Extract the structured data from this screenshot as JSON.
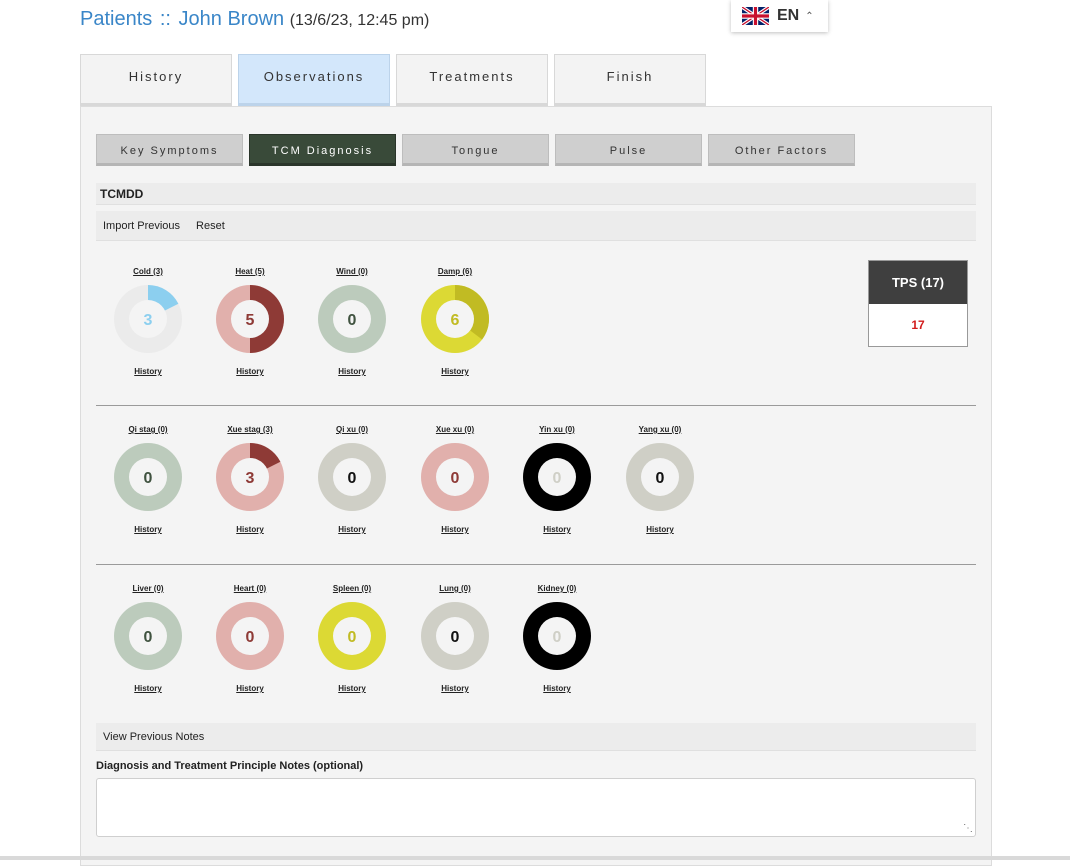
{
  "breadcrumb": {
    "root": "Patients",
    "separator": "::",
    "patient": "John Brown",
    "datetime": "(13/6/23, 12:45 pm)"
  },
  "language": {
    "code": "EN",
    "flag_icon": "uk-flag-icon"
  },
  "tabs": [
    {
      "label": "History",
      "active": false
    },
    {
      "label": "Observations",
      "active": true
    },
    {
      "label": "Treatments",
      "active": false
    },
    {
      "label": "Finish",
      "active": false
    }
  ],
  "subtabs": [
    {
      "label": "Key Symptoms",
      "active": false
    },
    {
      "label": "TCM Diagnosis",
      "active": true
    },
    {
      "label": "Tongue",
      "active": false
    },
    {
      "label": "Pulse",
      "active": false
    },
    {
      "label": "Other Factors",
      "active": false
    }
  ],
  "section_title": "TCMDD",
  "actions": {
    "import_previous": "Import Previous",
    "reset": "Reset"
  },
  "history_label": "History",
  "gauges_row1": [
    {
      "label": "Cold (3)",
      "value": "3",
      "fraction": 0.176,
      "fill": "#8ccfef",
      "track": "#ebebeb",
      "center": "#f4f4f4",
      "text": "#8ccfef"
    },
    {
      "label": "Heat (5)",
      "value": "5",
      "fraction": 0.5,
      "fill": "#8e3a36",
      "track": "#e1b0ac",
      "center": "#f4f4f4",
      "text": "#8e3a36"
    },
    {
      "label": "Wind (0)",
      "value": "0",
      "fraction": 0,
      "fill": "#bccbbc",
      "track": "#bccbbc",
      "center": "#f4f4f4",
      "text": "#3f523f"
    },
    {
      "label": "Damp (6)",
      "value": "6",
      "fraction": 0.353,
      "fill": "#c1bb23",
      "track": "#dcd934",
      "center": "#f4f4f4",
      "text": "#c1bb23"
    }
  ],
  "gauges_row2": [
    {
      "label": "Qi stag (0)",
      "value": "0",
      "fraction": 0,
      "fill": "#bccbbc",
      "track": "#bccbbc",
      "center": "#f4f4f4",
      "text": "#3f523f"
    },
    {
      "label": "Xue stag (3)",
      "value": "3",
      "fraction": 0.176,
      "fill": "#8e3a36",
      "track": "#e1b0ac",
      "center": "#f4f4f4",
      "text": "#8e3a36"
    },
    {
      "label": "Qi xu (0)",
      "value": "0",
      "fraction": 0,
      "fill": "#cfcfc6",
      "track": "#cfcfc6",
      "center": "#f4f4f4",
      "text": "#111111"
    },
    {
      "label": "Xue xu (0)",
      "value": "0",
      "fraction": 0,
      "fill": "#e1b0ac",
      "track": "#e1b0ac",
      "center": "#f4f4f4",
      "text": "#8e3a36"
    },
    {
      "label": "Yin xu (0)",
      "value": "0",
      "fraction": 0,
      "fill": "#000000",
      "track": "#000000",
      "center": "#f4f4f4",
      "text": "#cfcfc6"
    },
    {
      "label": "Yang xu (0)",
      "value": "0",
      "fraction": 0,
      "fill": "#cfcfc6",
      "track": "#cfcfc6",
      "center": "#f4f4f4",
      "text": "#111111"
    }
  ],
  "gauges_row3": [
    {
      "label": "Liver (0)",
      "value": "0",
      "fraction": 0,
      "fill": "#bccbbc",
      "track": "#bccbbc",
      "center": "#f4f4f4",
      "text": "#3f523f"
    },
    {
      "label": "Heart (0)",
      "value": "0",
      "fraction": 0,
      "fill": "#e1b0ac",
      "track": "#e1b0ac",
      "center": "#f4f4f4",
      "text": "#8e3a36"
    },
    {
      "label": "Spleen (0)",
      "value": "0",
      "fraction": 0,
      "fill": "#dcd934",
      "track": "#dcd934",
      "center": "#f4f4f4",
      "text": "#c1bb23"
    },
    {
      "label": "Lung (0)",
      "value": "0",
      "fraction": 0,
      "fill": "#cfcfc6",
      "track": "#cfcfc6",
      "center": "#f4f4f4",
      "text": "#111111"
    },
    {
      "label": "Kidney (0)",
      "value": "0",
      "fraction": 0,
      "fill": "#000000",
      "track": "#000000",
      "center": "#f4f4f4",
      "text": "#cfcfc6"
    }
  ],
  "tps": {
    "title": "TPS (17)",
    "value": "17"
  },
  "view_previous_notes": "View Previous Notes",
  "notes": {
    "label": "Diagnosis and Treatment Principle Notes (optional)",
    "value": ""
  }
}
